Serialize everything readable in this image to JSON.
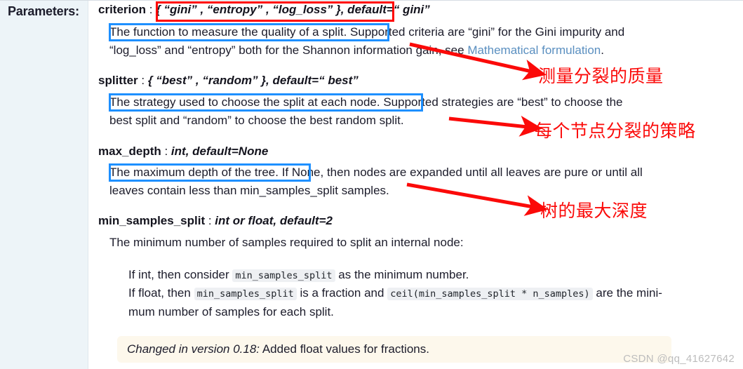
{
  "sidebar": {
    "label": "Parameters:"
  },
  "params": [
    {
      "name": "criterion",
      "separator": " : ",
      "type": "{ “gini” , “entropy” , “log_loss” }, default=“ gini”",
      "desc_highlight": "The function to measure the quality of a split.",
      "desc_rest_line1": "Supported criteria are  “gini”   for the Gini impurity and",
      "desc_line2_a": "“log_loss”  and  “entropy”  both for the Shannon information gain, see ",
      "desc_line2_link": "Mathematical formulation",
      "desc_line2_b": "."
    },
    {
      "name": "splitter",
      "separator": " : ",
      "type": "{ “best” ,  “random” }, default=“ best”",
      "desc_highlight": "The strategy used to choose the split at each node.",
      "desc_rest_line1": "Supported strategies are  “best”   to choose the",
      "desc_line2_a": "best split and  “random”   to choose the best random split."
    },
    {
      "name": "max_depth",
      "separator": " : ",
      "type": "int, default=None",
      "desc_highlight": "The maximum depth of the tree.",
      "desc_rest_line1": "If None, then nodes are expanded until all leaves are pure or until all",
      "desc_line2_a": "leaves contain less than min_samples_split samples."
    },
    {
      "name": "min_samples_split",
      "separator": " : ",
      "type": "int or float, default=2",
      "desc_line1": "The minimum number of samples required to split an internal node:",
      "bullets": [
        {
          "pre": "If int, then consider ",
          "code": "min_samples_split",
          "post": " as the minimum number."
        },
        {
          "pre": "If float, then ",
          "code": "min_samples_split",
          "mid": " is a fraction and ",
          "code2": "ceil(min_samples_split * n_samples)",
          "post": " are the mini-",
          "wrap": "mum number of samples for each split."
        }
      ]
    }
  ],
  "changed_note": {
    "prefix": "Changed in version 0.18:",
    "text": " Added float values for fractions."
  },
  "annotations": [
    {
      "text": "测量分裂的质量"
    },
    {
      "text": "每个节点分裂的策略"
    },
    {
      "text": "树的最大深度"
    }
  ],
  "watermark": "CSDN @qq_41627642",
  "colors": {
    "red_box": "#ff0000",
    "blue_box": "#1e90ff",
    "annotation_red": "#fb0a09",
    "sidebar_bg": "#edf4f8",
    "note_bg": "#fdf8ec",
    "link": "#5a8fc0"
  }
}
